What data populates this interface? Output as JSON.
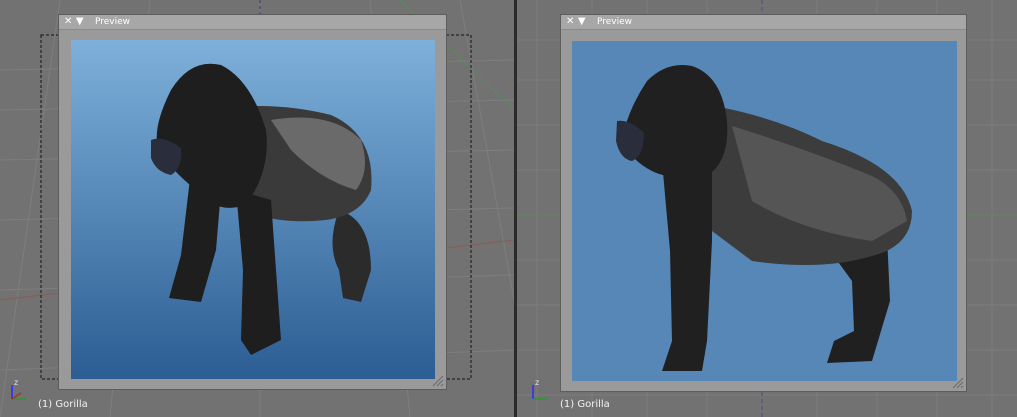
{
  "viewports": [
    {
      "preview": {
        "title": "Preview",
        "close_icon": "✕",
        "menu_icon": "▼"
      },
      "status": "(1) Gorilla",
      "axis": {
        "z": "z"
      }
    },
    {
      "preview": {
        "title": "Preview",
        "close_icon": "✕",
        "menu_icon": "▼"
      },
      "status": "(1) Gorilla",
      "axis": {
        "z": "z"
      }
    }
  ],
  "colors": {
    "left_sky_top": "#7eb0da",
    "left_sky_bottom": "#2c5d93",
    "right_sky": "#5787b6",
    "gorilla_dark": "#1e1e1e",
    "gorilla_back": "#5a5a5a"
  }
}
